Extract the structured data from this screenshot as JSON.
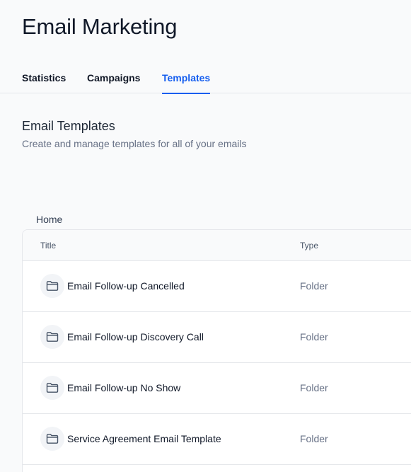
{
  "header": {
    "title": "Email Marketing"
  },
  "tabs": [
    {
      "label": "Statistics",
      "active": false
    },
    {
      "label": "Campaigns",
      "active": false
    },
    {
      "label": "Templates",
      "active": true
    }
  ],
  "section": {
    "title": "Email Templates",
    "subtitle": "Create and manage templates for all of your emails"
  },
  "breadcrumb": "Home",
  "table": {
    "columns": [
      "Title",
      "Type"
    ],
    "rows": [
      {
        "icon": "folder-icon",
        "title": "Email Follow-up Cancelled",
        "type": "Folder"
      },
      {
        "icon": "folder-icon",
        "title": "Email Follow-up Discovery Call",
        "type": "Folder"
      },
      {
        "icon": "folder-icon",
        "title": "Email Follow-up No Show",
        "type": "Folder"
      },
      {
        "icon": "folder-icon",
        "title": "Service Agreement Email Template",
        "type": "Folder"
      }
    ]
  },
  "colors": {
    "accent": "#155eef",
    "text": "#101828",
    "muted": "#667085",
    "border": "#e5e7eb"
  }
}
